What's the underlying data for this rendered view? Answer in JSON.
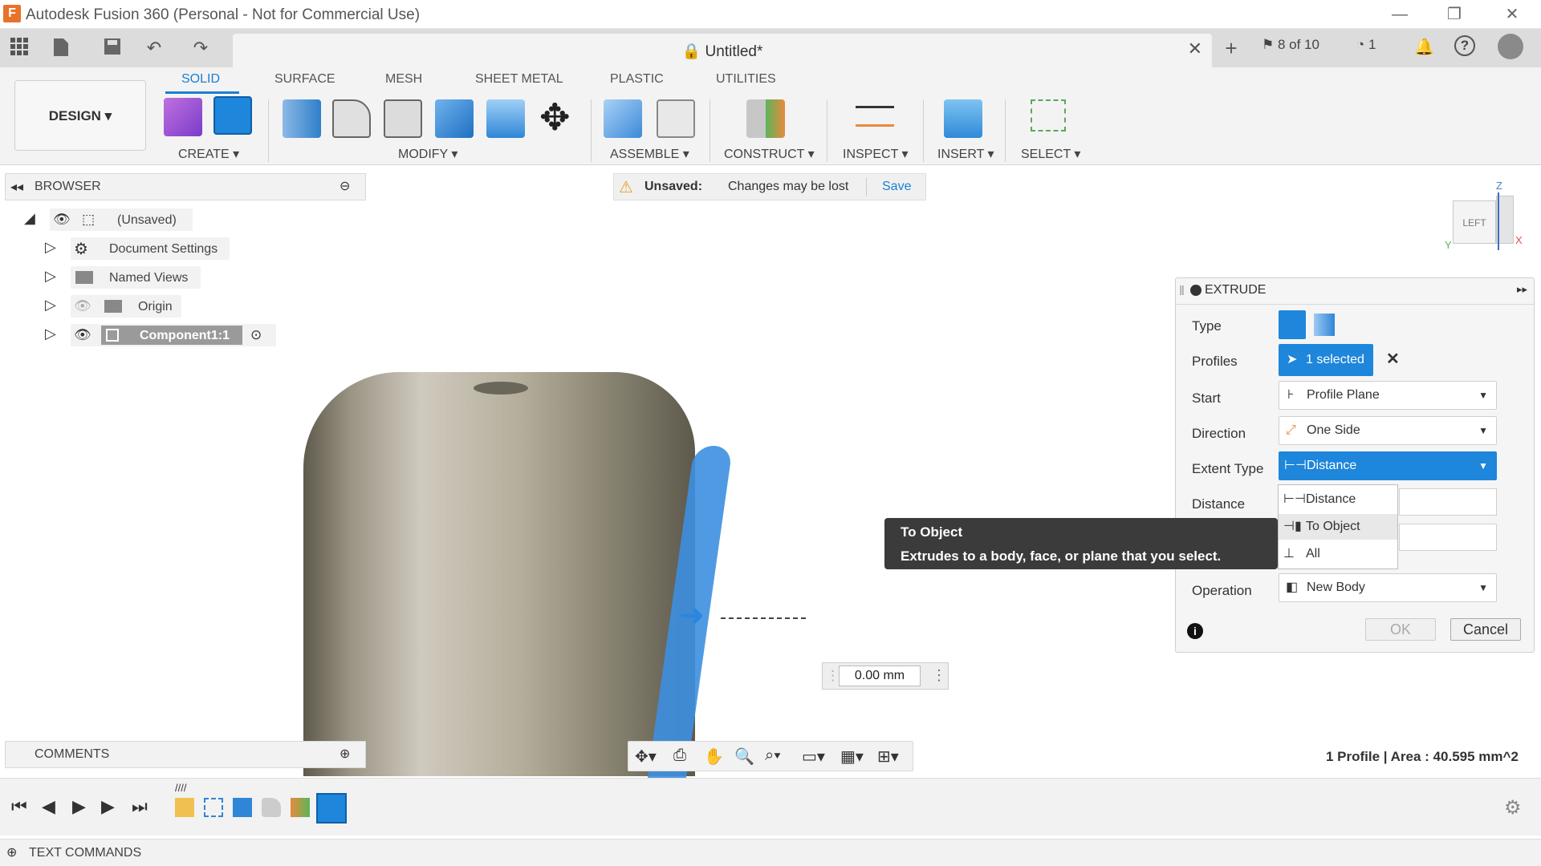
{
  "window": {
    "title": "Autodesk Fusion 360 (Personal - Not for Commercial Use)",
    "logo_letter": "F",
    "controls": [
      "—",
      "❐",
      "✕"
    ]
  },
  "tabbar": {
    "doc_title": "Untitled*",
    "close": "✕",
    "jobs": "8 of 10",
    "clock_count": "1"
  },
  "ribbon": {
    "workspace": "DESIGN ▾",
    "tabs": [
      "SOLID",
      "SURFACE",
      "MESH",
      "SHEET METAL",
      "PLASTIC",
      "UTILITIES"
    ],
    "active_tab": "SOLID",
    "groups": [
      "CREATE ▾",
      "MODIFY ▾",
      "ASSEMBLE ▾",
      "CONSTRUCT ▾",
      "INSPECT ▾",
      "INSERT ▾",
      "SELECT ▾"
    ]
  },
  "browser": {
    "title": "BROWSER",
    "root": "(Unsaved)",
    "items": [
      {
        "label": "Document Settings",
        "icon": "gear-icon"
      },
      {
        "label": "Named Views",
        "icon": "folder-icon"
      },
      {
        "label": "Origin",
        "icon": "folder-icon"
      },
      {
        "label": "Component1:1",
        "icon": "component-icon"
      }
    ]
  },
  "notice": {
    "label": "Unsaved:",
    "message": "Changes may be lost",
    "action": "Save"
  },
  "viewcube": {
    "face": "LEFT",
    "axis_z": "Z",
    "axis_x": "X",
    "axis_y": "Y"
  },
  "extrude": {
    "title": "EXTRUDE",
    "rows": {
      "type": "Type",
      "profiles": "Profiles",
      "start": "Start",
      "direction": "Direction",
      "extent_type": "Extent Type",
      "distance": "Distance",
      "operation": "Operation"
    },
    "profiles_value": "1 selected",
    "start_value": "Profile Plane",
    "direction_value": "One Side",
    "extent_value": "Distance",
    "operation_value": "New Body",
    "ok": "OK",
    "cancel": "Cancel",
    "dropdown": [
      "Distance",
      "To Object",
      "All"
    ],
    "dropdown_highlight": "To Object"
  },
  "tooltip": {
    "title": "To Object",
    "body": "Extrudes to a body, face, or plane that you select."
  },
  "distance_box": {
    "value": "0.00 mm"
  },
  "comments": {
    "title": "COMMENTS"
  },
  "status": {
    "text": "1 Profile | Area : 40.595 mm^2"
  },
  "textcommands": {
    "title": "TEXT COMMANDS"
  },
  "colors": {
    "accent": "#1e86db",
    "ribbon": "#f3f3f3",
    "panel": "#f5f5f5"
  }
}
